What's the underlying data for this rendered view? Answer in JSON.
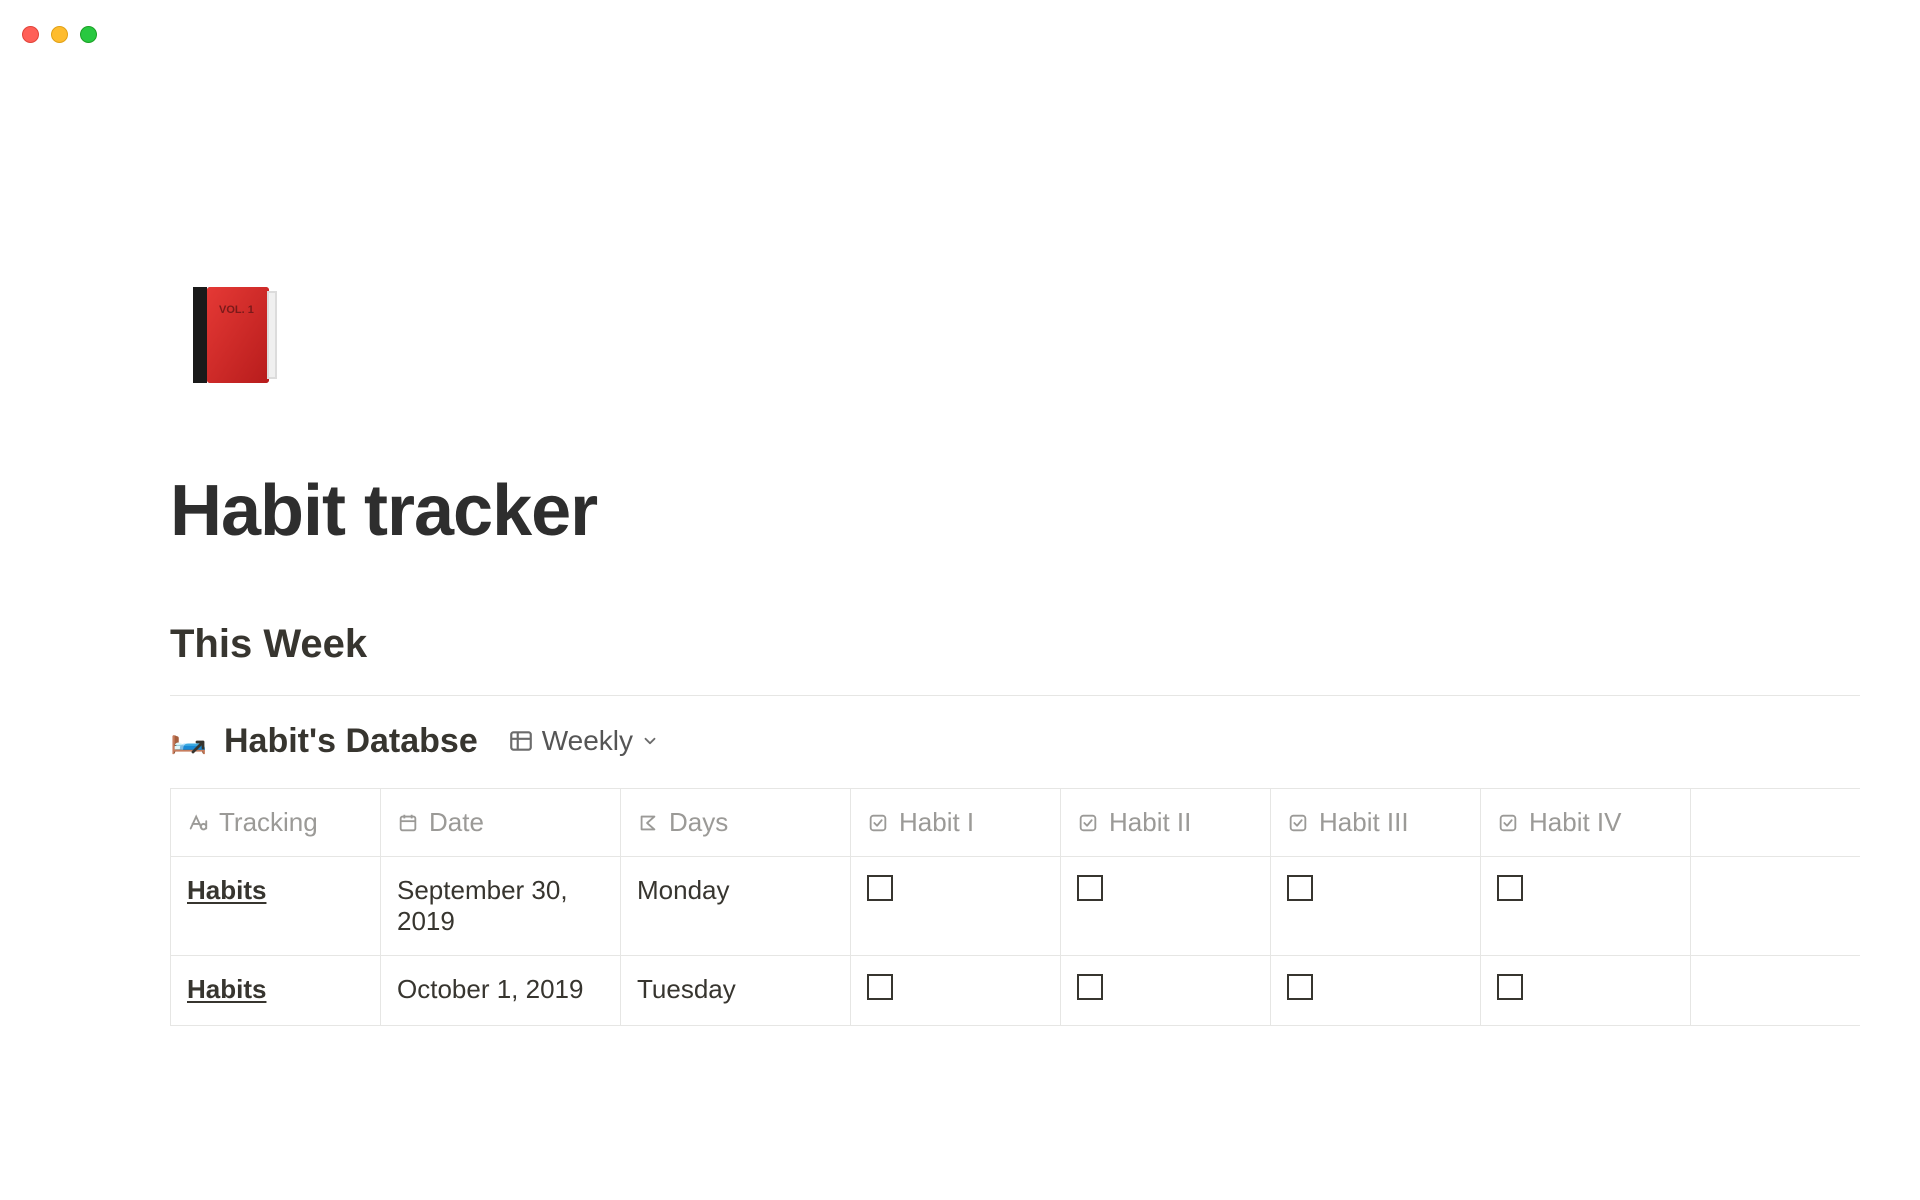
{
  "window": {
    "controls": {
      "close": "close",
      "min": "minimize",
      "max": "maximize"
    }
  },
  "page": {
    "icon_name": "closed-book-icon",
    "title": "Habit tracker",
    "section_heading": "This Week"
  },
  "database": {
    "icon": "🛏️",
    "icon_arrow": "↗",
    "title": "Habit's Databse",
    "view_label": "Weekly",
    "columns": [
      {
        "icon": "text",
        "label": "Tracking"
      },
      {
        "icon": "date",
        "label": "Date"
      },
      {
        "icon": "formula",
        "label": "Days"
      },
      {
        "icon": "checkbox",
        "label": "Habit I"
      },
      {
        "icon": "checkbox",
        "label": "Habit II"
      },
      {
        "icon": "checkbox",
        "label": "Habit III"
      },
      {
        "icon": "checkbox",
        "label": "Habit IV"
      }
    ],
    "rows": [
      {
        "tracking": "Habits",
        "date": "September 30, 2019",
        "days": "Monday",
        "h1": false,
        "h2": false,
        "h3": false,
        "h4": false
      },
      {
        "tracking": "Habits",
        "date": "October 1, 2019",
        "days": "Tuesday",
        "h1": false,
        "h2": false,
        "h3": false,
        "h4": false
      }
    ]
  }
}
